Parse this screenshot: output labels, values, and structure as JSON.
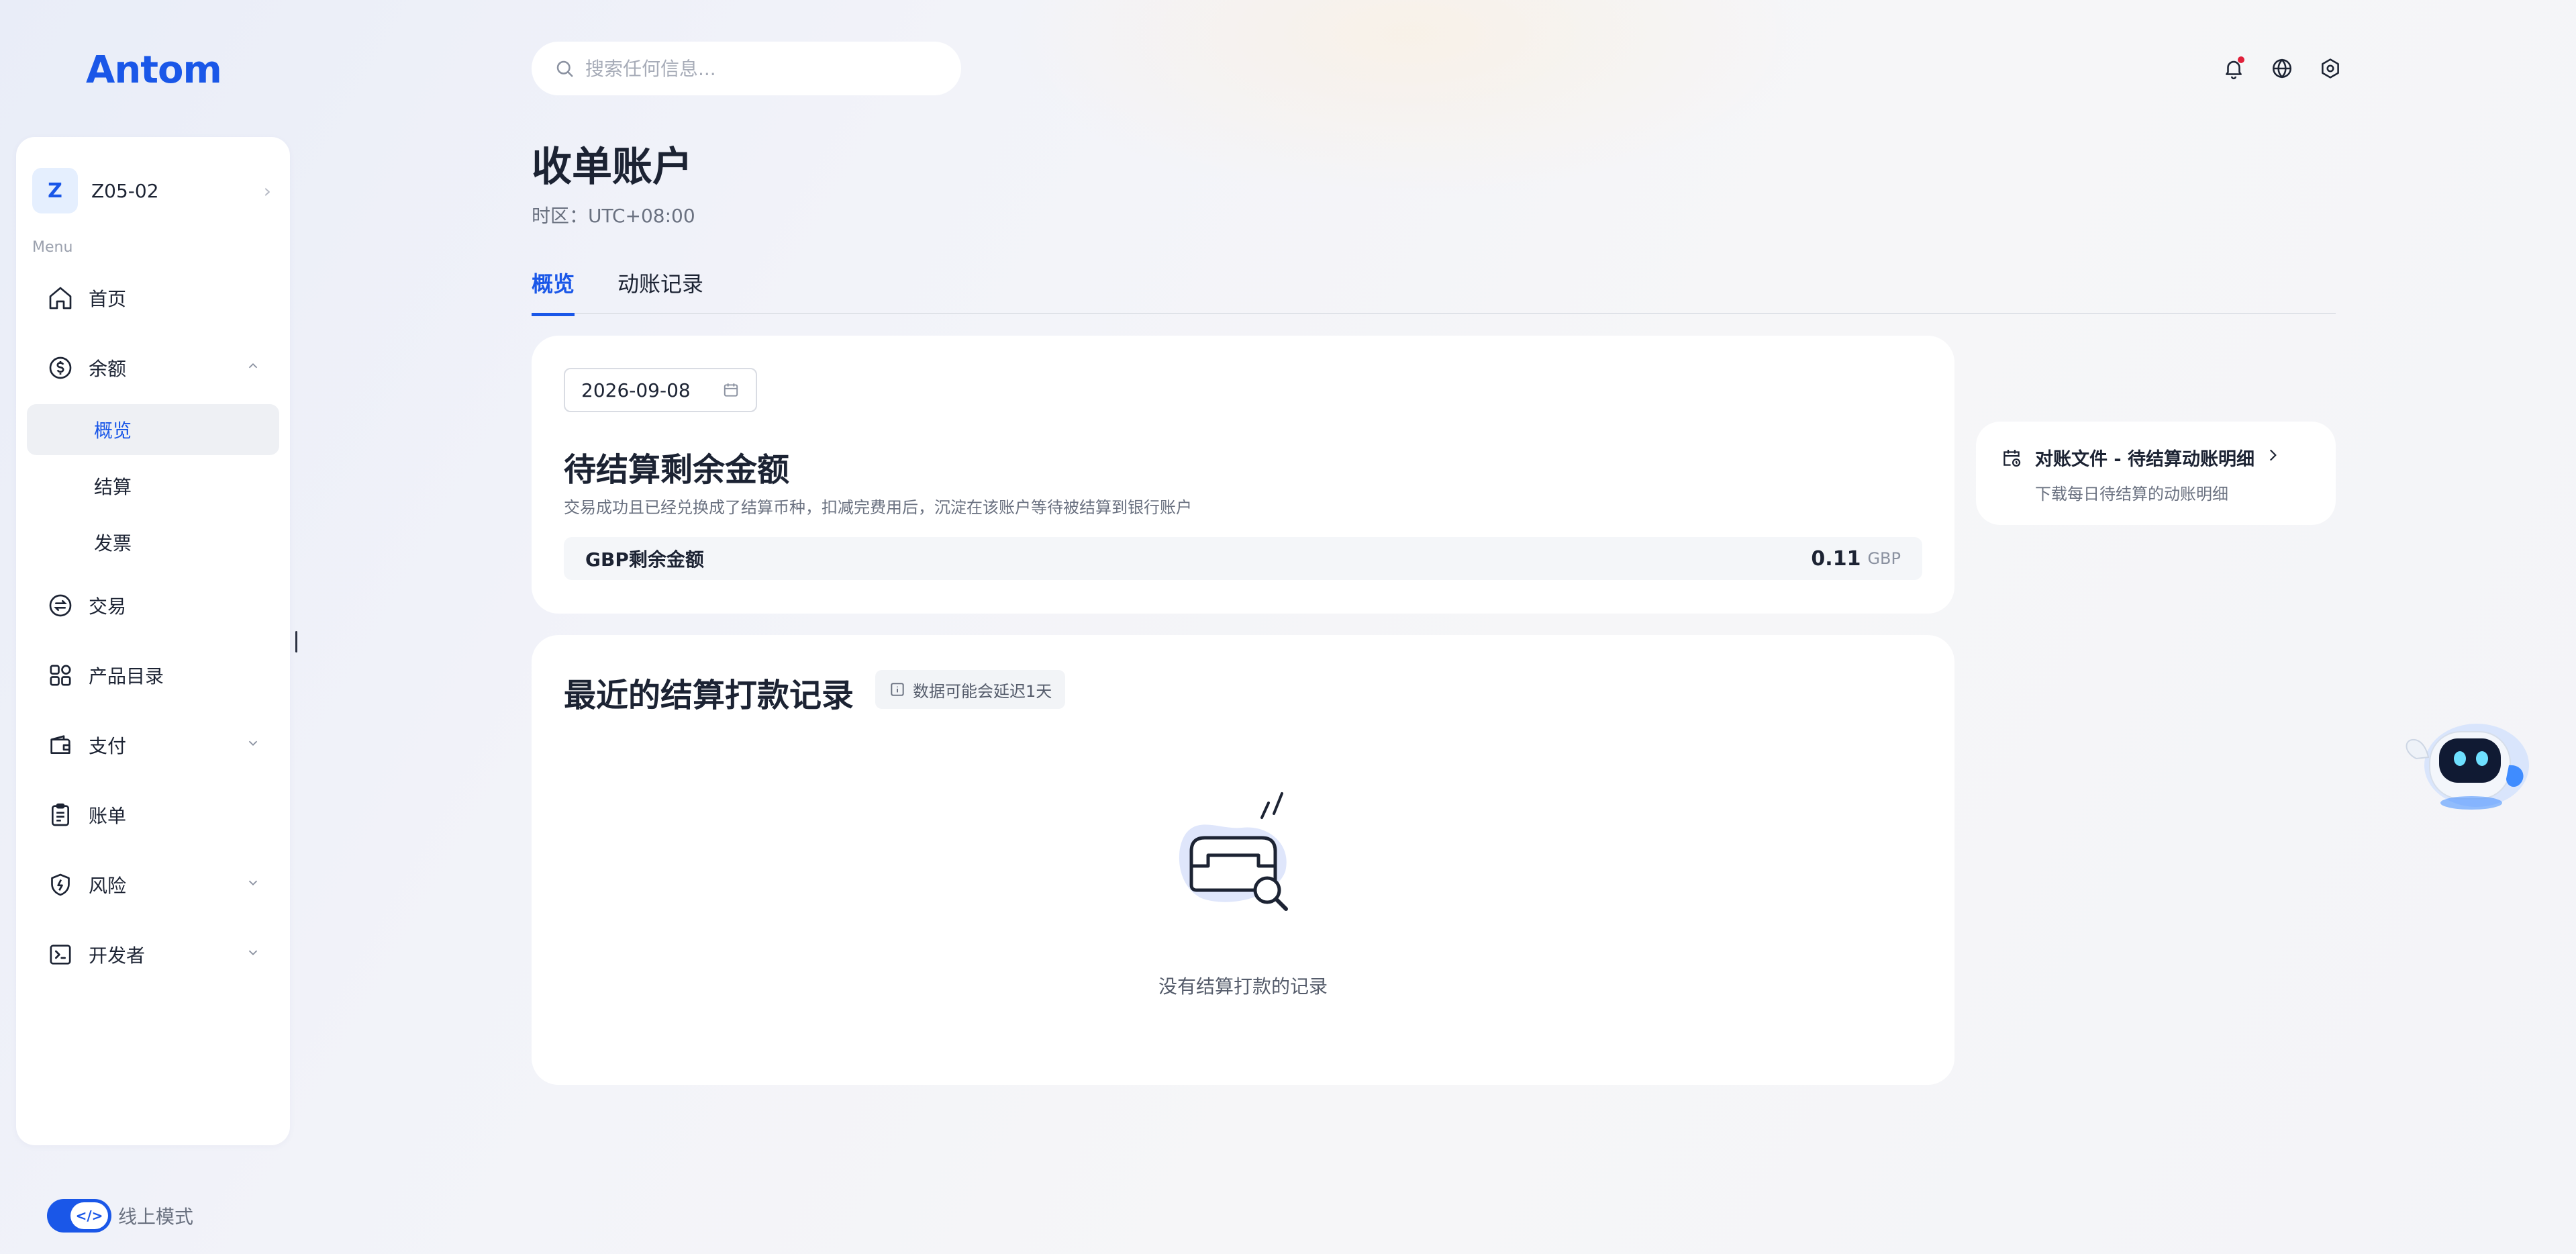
{
  "brand": {
    "logo_text": "Antom"
  },
  "search": {
    "placeholder": "搜索任何信息..."
  },
  "sidebar": {
    "account": {
      "initial": "Z",
      "name": "Z05-02"
    },
    "menu_label": "Menu",
    "items": [
      {
        "label": "首页",
        "icon": "home-icon"
      },
      {
        "label": "余额",
        "icon": "dollar-circle-icon",
        "expanded": true,
        "children": [
          {
            "label": "概览",
            "active": true
          },
          {
            "label": "结算"
          },
          {
            "label": "发票"
          }
        ]
      },
      {
        "label": "交易",
        "icon": "exchange-icon"
      },
      {
        "label": "产品目录",
        "icon": "grid-icon"
      },
      {
        "label": "支付",
        "icon": "wallet-icon",
        "expandable": true
      },
      {
        "label": "账单",
        "icon": "clipboard-icon"
      },
      {
        "label": "风险",
        "icon": "shield-icon",
        "expandable": true
      },
      {
        "label": "开发者",
        "icon": "terminal-icon",
        "expandable": true
      }
    ],
    "mode": {
      "label": "线上模式",
      "enabled": true,
      "knob_glyph": "</>"
    }
  },
  "header": {
    "title": "收单账户",
    "timezone": "时区：UTC+08:00",
    "tabs": [
      {
        "label": "概览",
        "active": true
      },
      {
        "label": "动账记录",
        "active": false
      }
    ]
  },
  "balance_card": {
    "date": "2026-09-08",
    "title": "待结算剩余金额",
    "description": "交易成功且已经兑换成了结算币种，扣减完费用后，沉淀在该账户等待被结算到银行账户",
    "row": {
      "label": "GBP剩余金额",
      "amount": "0.11",
      "currency": "GBP"
    }
  },
  "recon_card": {
    "title": "对账文件 - 待结算动账明细",
    "subtitle": "下载每日待结算的动账明细"
  },
  "records_card": {
    "title": "最近的结算打款记录",
    "badge": "数据可能会延迟1天",
    "empty_text": "没有结算打款的记录"
  },
  "colors": {
    "accent": "#1a57e8",
    "notification_dot": "#e0203a",
    "text_primary": "#1c2333",
    "text_secondary": "#6a7180"
  }
}
